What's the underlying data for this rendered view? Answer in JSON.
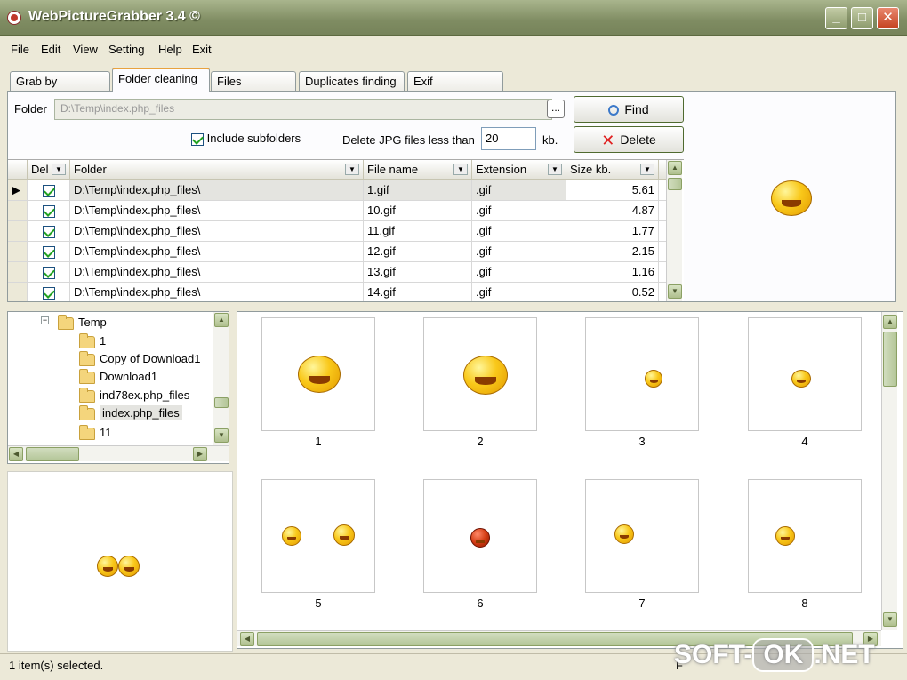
{
  "window": {
    "title": "WebPictureGrabber 3.4 ©"
  },
  "menu": [
    "File",
    "Edit",
    "View",
    "Setting",
    "Help",
    "Exit"
  ],
  "tabs": [
    "Grab by template",
    "Folder cleaning",
    "Files renaming",
    "Duplicates finding",
    "Exif informations"
  ],
  "active_tab": "Folder cleaning",
  "form": {
    "folder_label": "Folder",
    "folder_value": "D:\\Temp\\index.php_files",
    "browse_label": "...",
    "include_subfolders_label": "Include subfolders",
    "include_subfolders_checked": true,
    "delete_jpg_label": "Delete JPG files less than",
    "delete_jpg_value": "20",
    "kb_label": "kb."
  },
  "buttons": {
    "find": "Find",
    "delete": "Delete"
  },
  "grid": {
    "columns": [
      "Del",
      "Folder",
      "File name",
      "Extension",
      "Size kb."
    ],
    "rows": [
      {
        "del": true,
        "folder": "D:\\Temp\\index.php_files\\",
        "file": "1.gif",
        "ext": ".gif",
        "size": "5.61"
      },
      {
        "del": true,
        "folder": "D:\\Temp\\index.php_files\\",
        "file": "10.gif",
        "ext": ".gif",
        "size": "4.87"
      },
      {
        "del": true,
        "folder": "D:\\Temp\\index.php_files\\",
        "file": "11.gif",
        "ext": ".gif",
        "size": "1.77"
      },
      {
        "del": true,
        "folder": "D:\\Temp\\index.php_files\\",
        "file": "12.gif",
        "ext": ".gif",
        "size": "2.15"
      },
      {
        "del": true,
        "folder": "D:\\Temp\\index.php_files\\",
        "file": "13.gif",
        "ext": ".gif",
        "size": "1.16"
      },
      {
        "del": true,
        "folder": "D:\\Temp\\index.php_files\\",
        "file": "14.gif",
        "ext": ".gif",
        "size": "0.52"
      }
    ]
  },
  "tree": {
    "root": "Temp",
    "children": [
      "1",
      "Copy of Download1",
      "Download1",
      "ind78ex.php_files",
      "index.php_files",
      "11"
    ],
    "selected": "index.php_files"
  },
  "thumbnails": [
    "1",
    "2",
    "3",
    "4",
    "5",
    "6",
    "7",
    "8"
  ],
  "status": {
    "text": "1 item(s) selected.",
    "right": "F"
  },
  "watermark": {
    "left": "SOFT-",
    "ok": "OK",
    "right": ".NET"
  }
}
